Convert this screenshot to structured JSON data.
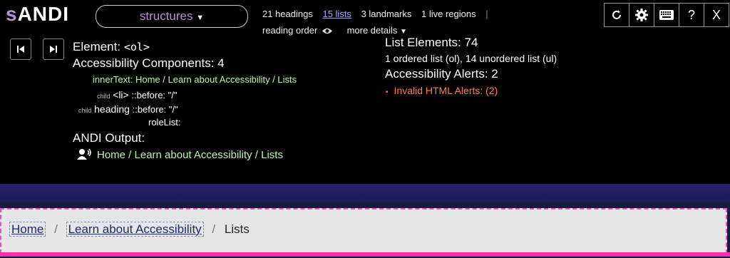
{
  "toolbar": {
    "logo_s": "s",
    "logo_rest": "ANDI",
    "module_label": "structures",
    "headings": "21 headings",
    "lists": "15 lists",
    "landmarks": "3 landmarks",
    "live_regions": "1 live regions",
    "separator": "|",
    "reading_order": "reading order",
    "more_details": "more details",
    "help_label": "?",
    "close_label": "X"
  },
  "element": {
    "label": "Element:",
    "tag": "<ol>"
  },
  "components": {
    "title": "Accessibility Components: 4",
    "innertext_label": "innerText:",
    "innertext_value": "Home / Learn about Accessibility / Lists",
    "child1_prefix": "child",
    "child1_tag": "<li>",
    "child1_value": "::before: \"/\"",
    "child2_prefix": "child",
    "child2_tag": "heading",
    "child2_value": "::before: \"/\"",
    "rolelist_label": "roleList:"
  },
  "output": {
    "title": "ANDI Output:",
    "text": "Home / Learn about Accessibility / Lists"
  },
  "summary": {
    "list_elements": "List Elements: 74",
    "breakdown": "1 ordered list (ol), 14 unordered list (ul)",
    "alerts_title": "Accessibility Alerts: 2",
    "alert_item": "Invalid HTML Alerts: (2)"
  },
  "breadcrumb": {
    "home": "Home",
    "learn": "Learn about Accessibility",
    "current": "Lists",
    "sep": "/"
  },
  "colors": {
    "accent_purple": "#b88fd8",
    "link_blue": "#a5a5ff",
    "output_green": "#bff3b4",
    "alert_orange": "#ff7a5a",
    "highlight_pink": "#ff2faa"
  }
}
